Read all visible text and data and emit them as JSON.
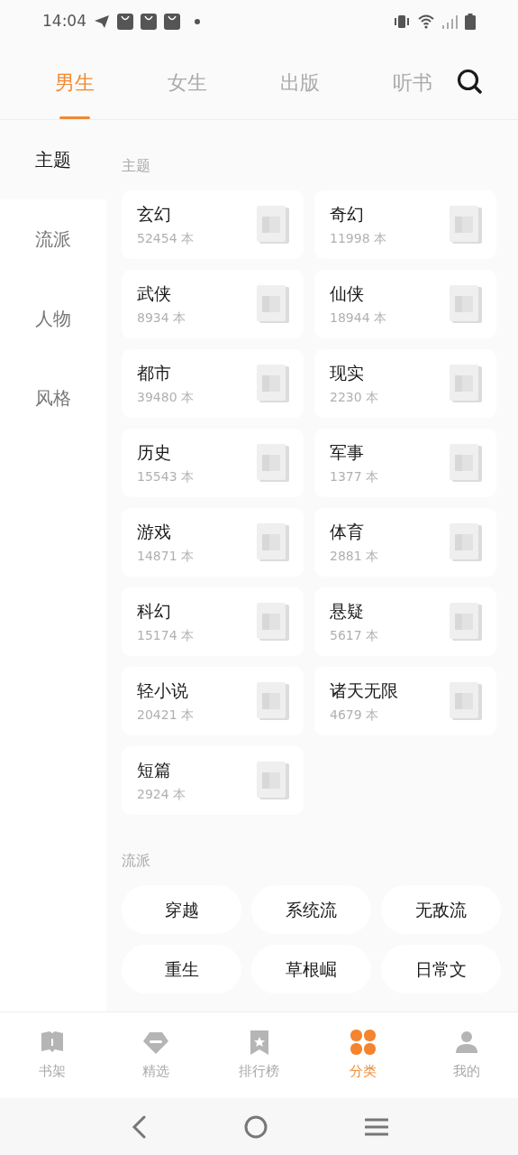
{
  "status_bar": {
    "time": "14:04"
  },
  "tabs": [
    {
      "label": "男生",
      "selected": true
    },
    {
      "label": "女生",
      "selected": false
    },
    {
      "label": "出版",
      "selected": false
    },
    {
      "label": "听书",
      "selected": false
    }
  ],
  "sidebar": {
    "items": [
      {
        "label": "主题",
        "selected": true
      },
      {
        "label": "流派",
        "selected": false
      },
      {
        "label": "人物",
        "selected": false
      },
      {
        "label": "风格",
        "selected": false
      }
    ]
  },
  "sections": [
    {
      "title": "主题",
      "kind": "cards",
      "items": [
        {
          "name": "玄幻",
          "count": "52454 本"
        },
        {
          "name": "奇幻",
          "count": "11998 本"
        },
        {
          "name": "武侠",
          "count": "8934 本"
        },
        {
          "name": "仙侠",
          "count": "18944 本"
        },
        {
          "name": "都市",
          "count": "39480 本"
        },
        {
          "name": "现实",
          "count": "2230 本"
        },
        {
          "name": "历史",
          "count": "15543 本"
        },
        {
          "name": "军事",
          "count": "1377 本"
        },
        {
          "name": "游戏",
          "count": "14871 本"
        },
        {
          "name": "体育",
          "count": "2881 本"
        },
        {
          "name": "科幻",
          "count": "15174 本"
        },
        {
          "name": "悬疑",
          "count": "5617 本"
        },
        {
          "name": "轻小说",
          "count": "20421 本"
        },
        {
          "name": "诸天无限",
          "count": "4679 本"
        },
        {
          "name": "短篇",
          "count": "2924 本"
        }
      ]
    },
    {
      "title": "流派",
      "kind": "pills",
      "items": [
        {
          "name": "穿越"
        },
        {
          "name": "系统流"
        },
        {
          "name": "无敌流"
        },
        {
          "name": "重生"
        },
        {
          "name": "草根崛"
        },
        {
          "name": "日常文"
        }
      ]
    }
  ],
  "bottom_nav": [
    {
      "label": "书架",
      "selected": false
    },
    {
      "label": "精选",
      "selected": false
    },
    {
      "label": "排行榜",
      "selected": false
    },
    {
      "label": "分类",
      "selected": true
    },
    {
      "label": "我的",
      "selected": false
    }
  ]
}
